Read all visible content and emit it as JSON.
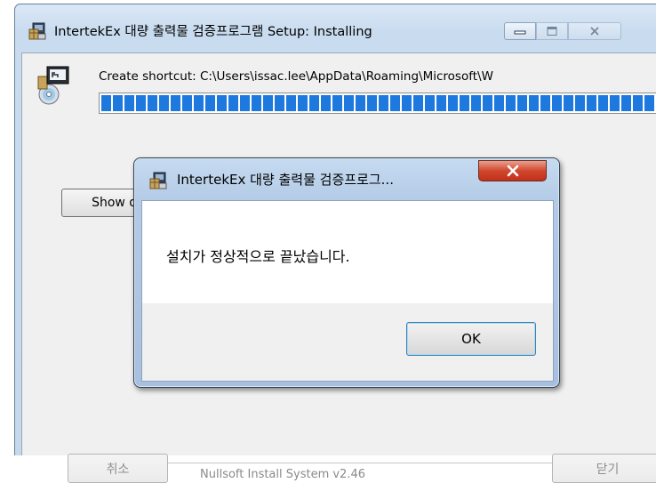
{
  "installer": {
    "title": "IntertekEx 대량 출력물 검증프로그램 Setup: Installing",
    "status_text": "Create shortcut: C:\\Users\\issac.lee\\AppData\\Roaming\\Microsoft\\W",
    "progress_percent": 100,
    "show_details_label": "Show details",
    "cancel_label": "취소",
    "branding": "Nullsoft Install System v2.46",
    "close_label": "닫기"
  },
  "message_box": {
    "title": "IntertekEx 대량 출력물 검증프로그...",
    "message": "설치가 정상적으로 끝났습니다.",
    "ok_label": "OK"
  },
  "icons": {
    "app": "installer-package-icon",
    "status": "shortcut-cd-icon",
    "close": "close-x-icon"
  },
  "colors": {
    "progress": "#1d79dd",
    "close_button": "#c9371f"
  }
}
